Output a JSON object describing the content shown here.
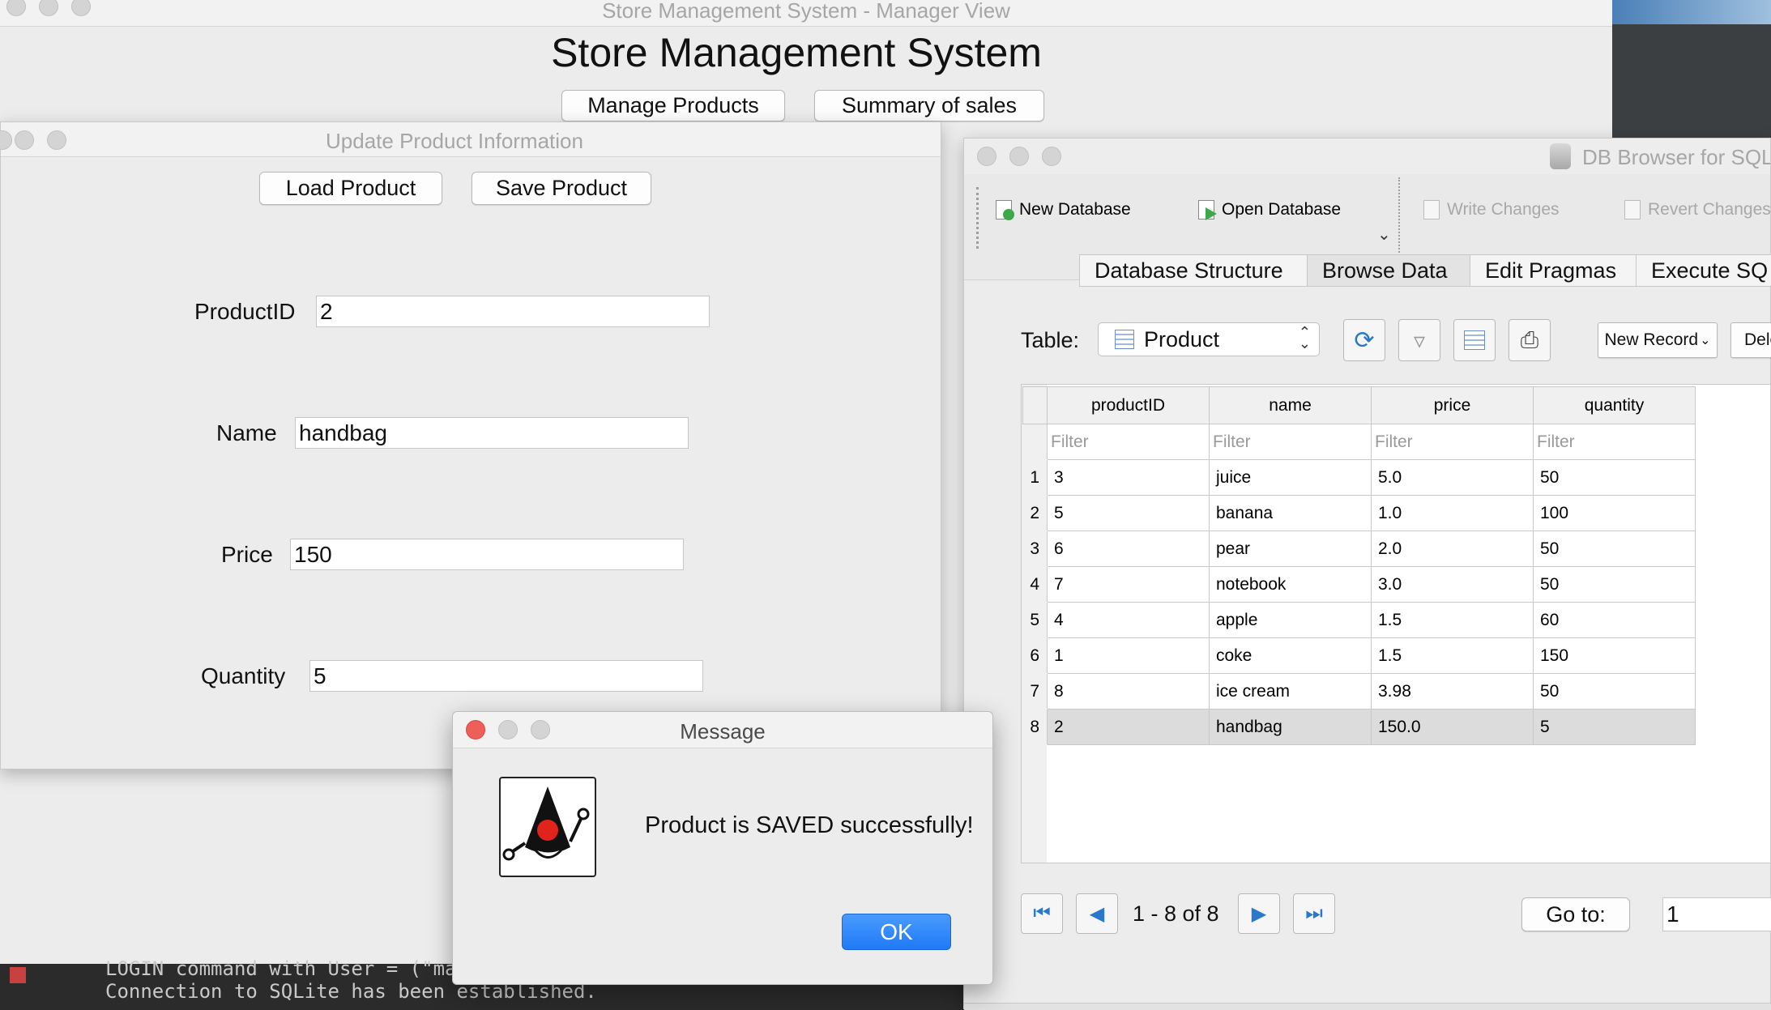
{
  "main_window": {
    "title": "Store Management System - Manager View",
    "heading": "Store Management System",
    "buttons": {
      "manage_products": "Manage Products",
      "summary_of_sales": "Summary of sales"
    }
  },
  "update_window": {
    "title": "Update Product Information",
    "buttons": {
      "load": "Load Product",
      "save": "Save Product"
    },
    "fields": {
      "product_id": {
        "label": "ProductID",
        "value": "2"
      },
      "name": {
        "label": "Name",
        "value": "handbag"
      },
      "price": {
        "label": "Price",
        "value": "150"
      },
      "quantity": {
        "label": "Quantity",
        "value": "5"
      }
    }
  },
  "db_browser": {
    "title": "DB Browser for SQL",
    "toolbar": {
      "new_database": "New Database",
      "open_database": "Open Database",
      "write_changes": "Write Changes",
      "revert_changes": "Revert Changes"
    },
    "tabs": [
      "Database Structure",
      "Browse Data",
      "Edit Pragmas",
      "Execute SQ"
    ],
    "active_tab": "Browse Data",
    "table_label": "Table:",
    "table_selected": "Product",
    "new_record": "New Record",
    "delete_partial": "Dele",
    "columns": [
      "productID",
      "name",
      "price",
      "quantity"
    ],
    "filter_placeholder": "Filter",
    "rows": [
      [
        "1",
        "3",
        "juice",
        "5.0",
        "50"
      ],
      [
        "2",
        "5",
        "banana",
        "1.0",
        "100"
      ],
      [
        "3",
        "6",
        "pear",
        "2.0",
        "50"
      ],
      [
        "4",
        "7",
        "notebook",
        "3.0",
        "50"
      ],
      [
        "5",
        "4",
        "apple",
        "1.5",
        "60"
      ],
      [
        "6",
        "1",
        "coke",
        "1.5",
        "150"
      ],
      [
        "7",
        "8",
        "ice cream",
        "3.98",
        "50"
      ],
      [
        "8",
        "2",
        "handbag",
        "150.0",
        "5"
      ]
    ],
    "selected_row": 8,
    "pagination": "1 - 8 of 8",
    "goto_label": "Go to:",
    "goto_value": "1"
  },
  "dialog": {
    "title": "Message",
    "message": "Product is SAVED successfully!",
    "ok": "OK"
  },
  "console": {
    "line1": "LOGIN command with User = (\"mar",
    "line2": "Connection to SQLite has been established."
  },
  "colors": {
    "accent": "#1f7af5",
    "window_bg": "#ececec",
    "close_red": "#ee5f57"
  }
}
